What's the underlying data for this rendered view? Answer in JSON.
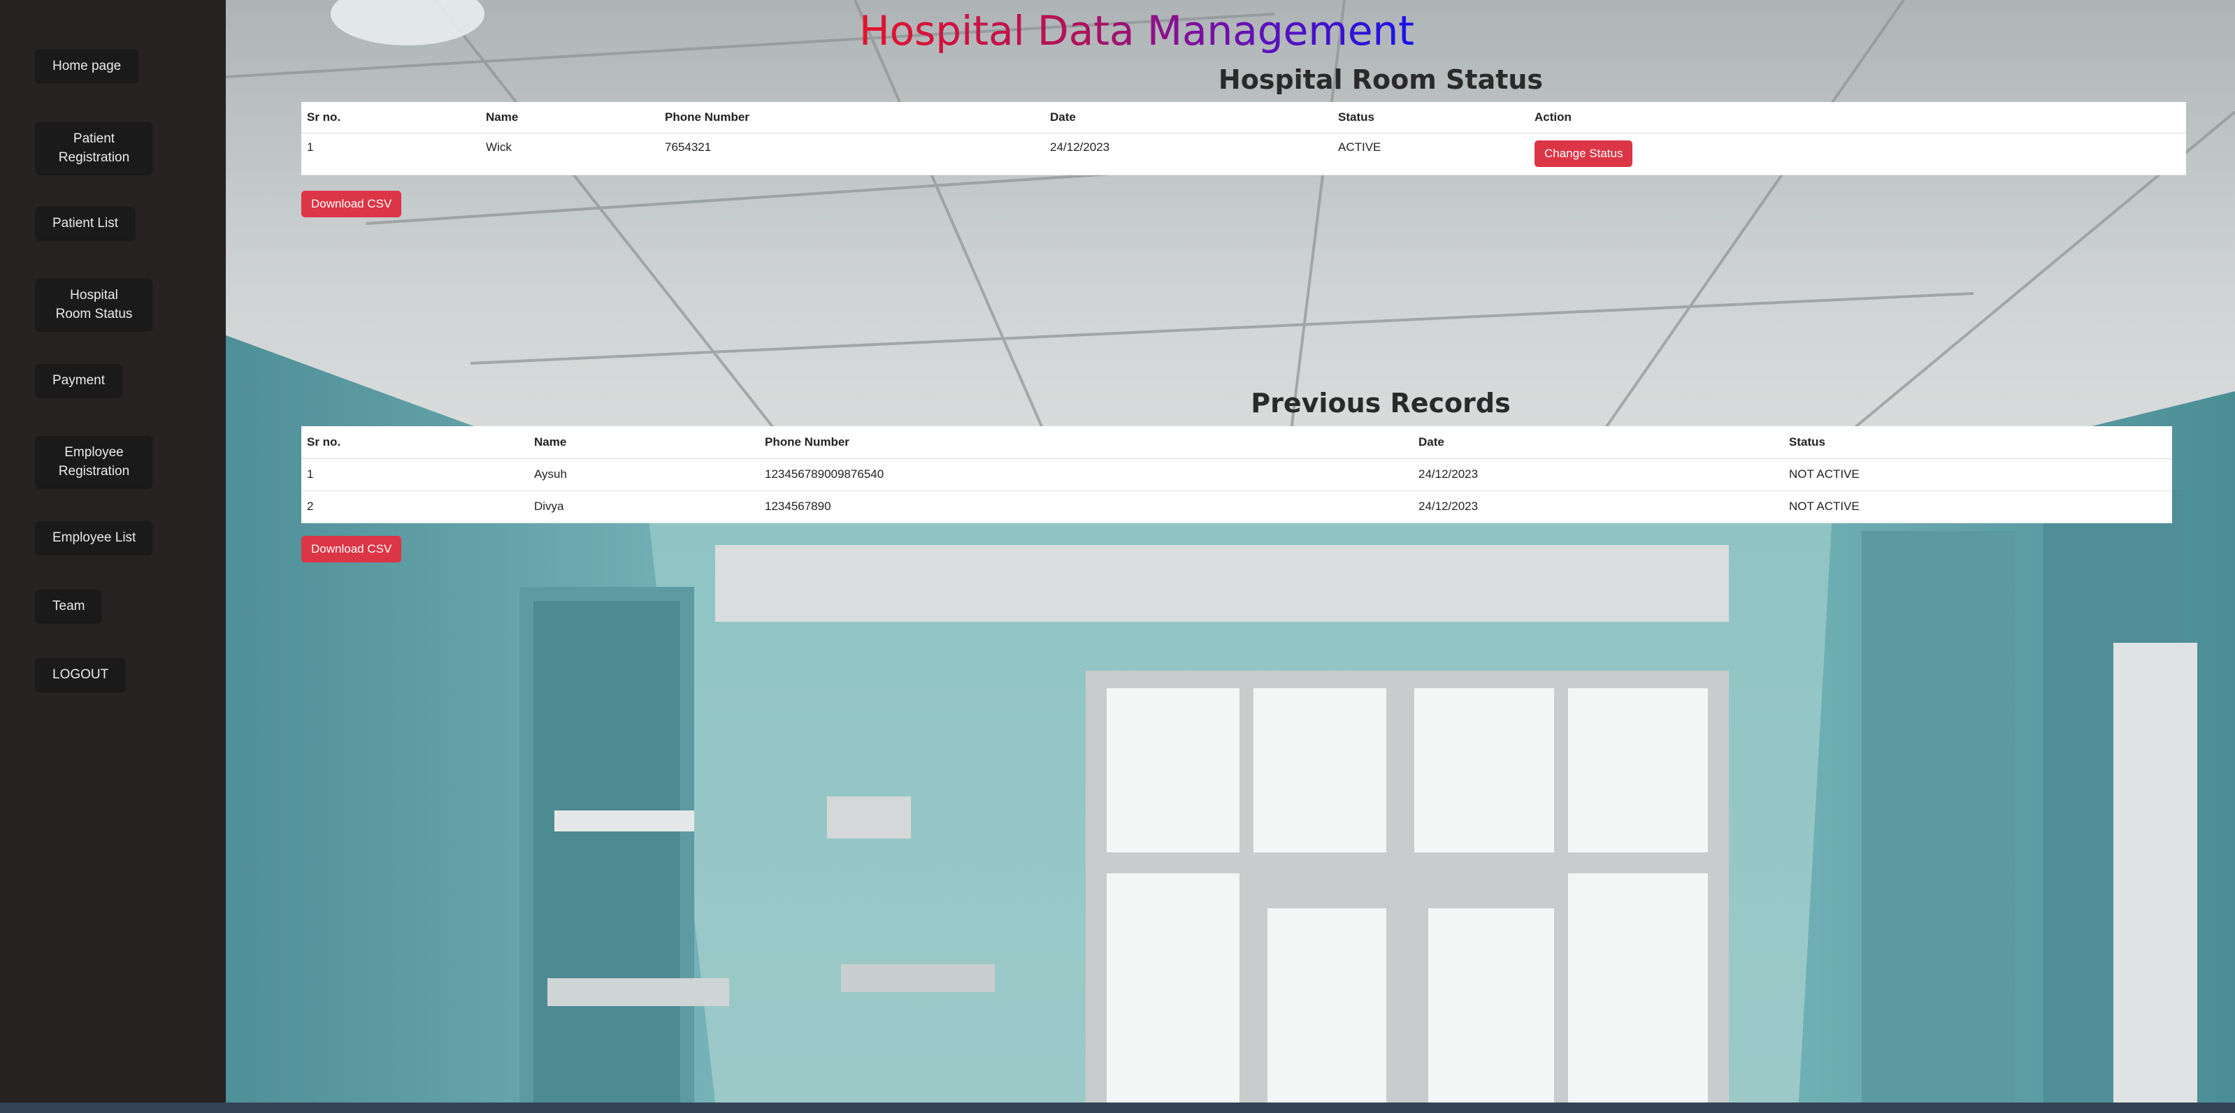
{
  "sidebar": {
    "items": [
      {
        "label": "Home page"
      },
      {
        "label": "Patient Registration"
      },
      {
        "label": "Patient List"
      },
      {
        "label": "Hospital Room Status"
      },
      {
        "label": "Payment"
      },
      {
        "label": "Employee Registration"
      },
      {
        "label": "Employee List"
      },
      {
        "label": "Team"
      },
      {
        "label": "LOGOUT"
      }
    ]
  },
  "header": {
    "title": "Hospital Data Management"
  },
  "room_status": {
    "title": "Hospital Room Status",
    "columns": [
      "Sr no.",
      "Name",
      "Phone Number",
      "Date",
      "Status",
      "Action"
    ],
    "rows": [
      {
        "sr": "1",
        "name": "Wick",
        "phone": "7654321",
        "date": "24/12/2023",
        "status": "ACTIVE",
        "action_label": "Change Status"
      }
    ],
    "download_label": "Download CSV"
  },
  "previous_records": {
    "title": "Previous Records",
    "columns": [
      "Sr no.",
      "Name",
      "Phone Number",
      "Date",
      "Status"
    ],
    "rows": [
      {
        "sr": "1",
        "name": "Aysuh",
        "phone": "123456789009876540",
        "date": "24/12/2023",
        "status": "NOT ACTIVE"
      },
      {
        "sr": "2",
        "name": "Divya",
        "phone": "1234567890",
        "date": "24/12/2023",
        "status": "NOT ACTIVE"
      }
    ],
    "download_label": "Download CSV"
  },
  "colors": {
    "sidebar_bg": "#262322",
    "button_red": "#dc3545",
    "title_gradient_start": "#e6132b",
    "title_gradient_end": "#1614ee"
  }
}
